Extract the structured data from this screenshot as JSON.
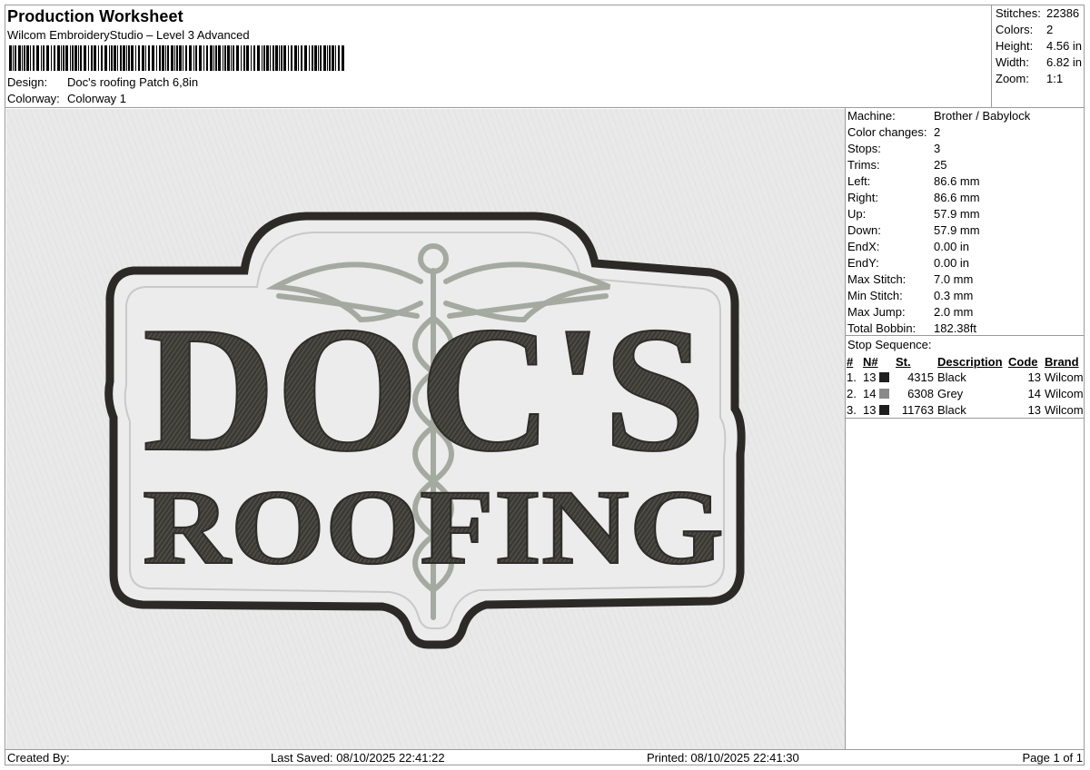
{
  "header": {
    "title": "Production Worksheet",
    "software": "Wilcom EmbroideryStudio – Level 3 Advanced",
    "design_label": "Design:",
    "design_value": "Doc's roofing Patch 6,8in",
    "colorway_label": "Colorway:",
    "colorway_value": "Colorway 1"
  },
  "stats": [
    {
      "label": "Stitches:",
      "value": "22386"
    },
    {
      "label": "Colors:",
      "value": "2"
    },
    {
      "label": "Height:",
      "value": "4.56 in"
    },
    {
      "label": "Width:",
      "value": "6.82 in"
    },
    {
      "label": "Zoom:",
      "value": "1:1"
    }
  ],
  "machine_info": [
    {
      "label": "Machine:",
      "value": "Brother / Babylock"
    },
    {
      "label": "Color changes:",
      "value": "2"
    },
    {
      "label": "Stops:",
      "value": "3"
    },
    {
      "label": "Trims:",
      "value": "25"
    },
    {
      "label": "Left:",
      "value": "86.6 mm"
    },
    {
      "label": "Right:",
      "value": "86.6 mm"
    },
    {
      "label": "Up:",
      "value": "57.9 mm"
    },
    {
      "label": "Down:",
      "value": "57.9 mm"
    },
    {
      "label": "EndX:",
      "value": "0.00 in"
    },
    {
      "label": "EndY:",
      "value": "0.00 in"
    },
    {
      "label": "Max Stitch:",
      "value": "7.0 mm"
    },
    {
      "label": "Min Stitch:",
      "value": "0.3 mm"
    },
    {
      "label": "Max Jump:",
      "value": "2.0 mm"
    },
    {
      "label": "Total Bobbin:",
      "value": "182.38ft"
    }
  ],
  "stop_sequence": {
    "title": "Stop Sequence:",
    "columns": [
      "#",
      "N#",
      "St.",
      "Description",
      "Code",
      "Brand"
    ],
    "rows": [
      {
        "num": "1.",
        "n": "13",
        "color": "#1f1f1f",
        "st": "4315",
        "desc": "Black",
        "code": "13",
        "brand": "Wilcom"
      },
      {
        "num": "2.",
        "n": "14",
        "color": "#8a8a8a",
        "st": "6308",
        "desc": "Grey",
        "code": "14",
        "brand": "Wilcom"
      },
      {
        "num": "3.",
        "n": "13",
        "color": "#1f1f1f",
        "st": "11763",
        "desc": "Black",
        "code": "13",
        "brand": "Wilcom"
      }
    ]
  },
  "design_preview": {
    "line1": "DOC'S",
    "line2": "ROOFING",
    "thread_dark": "#3a3934",
    "thread_grey": "#a5aaa0",
    "fabric": "#e9e9e9"
  },
  "footer": {
    "created_by": "Created By:",
    "last_saved": "Last Saved: 08/10/2025 22:41:22",
    "printed": "Printed: 08/10/2025 22:41:30",
    "page": "Page 1 of 1"
  }
}
